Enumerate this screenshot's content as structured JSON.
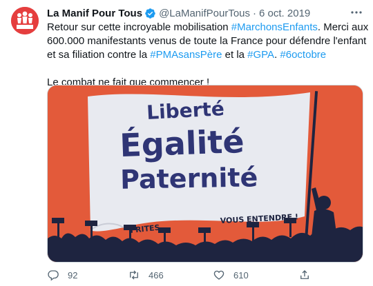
{
  "tweet": {
    "author_name": "La Manif Pour Tous",
    "author_handle": "@LaManifPourTous",
    "separator": "·",
    "date": "6 oct. 2019",
    "avatar_label": "LA MANIF POUR TOUS",
    "body": {
      "t1": "Retour sur cette incroyable mobilisation ",
      "h1": "#MarchonsEnfants",
      "t2": ". Merci aux 600.000 manifestants venus de toute la France pour défendre l'enfant et sa filiation contre la ",
      "h2": "#PMAsansPère",
      "t3": " et la ",
      "h3": "#GPA",
      "t4": ". ",
      "h4": "#6octobre",
      "line2": "Le combat ne fait que commencer !"
    },
    "image": {
      "line1": "Liberté",
      "line2": "Égalité",
      "line3": "Paternité",
      "word_left": "FRITES",
      "word_right": "VOUS ENTENDRE !"
    },
    "actions": {
      "replies": "92",
      "retweets": "466",
      "likes": "610"
    }
  },
  "colors": {
    "link": "#1d9bf0",
    "image_bg": "#e35a3a",
    "flag": "#e8eaf0",
    "flag_text": "#2f3575",
    "crowd": "#1e2440"
  },
  "icons": [
    "verified-badge-icon",
    "more-options-icon",
    "reply-icon",
    "retweet-icon",
    "like-icon",
    "share-icon"
  ]
}
